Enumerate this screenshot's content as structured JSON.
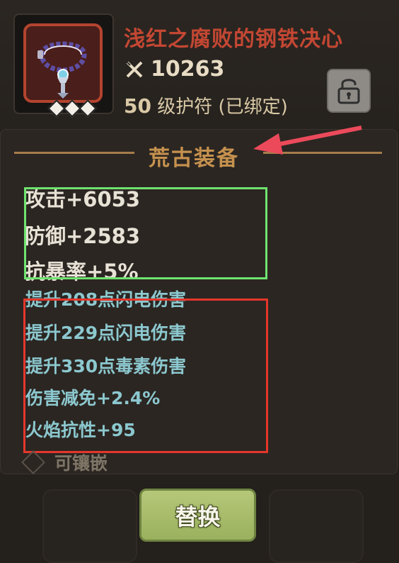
{
  "item": {
    "name": "浅红之腐败的钢铁决心",
    "power": "10263",
    "level_num": "50",
    "level_text": "级护符",
    "bound_text": "(已绑定)",
    "rarity_diamonds": 3
  },
  "section": {
    "title": "荒古装备"
  },
  "base_stats": [
    "攻击+6053",
    "防御+2583",
    "抗暴率+5%"
  ],
  "sub_stats": [
    "提升208点闪电伤害",
    "提升229点闪电伤害",
    "提升330点毒素伤害",
    "伤害减免+2.4%",
    "火焰抗性+95"
  ],
  "socket": {
    "label": "可镶嵌"
  },
  "actions": {
    "replace_label": "替换"
  },
  "colors": {
    "item_name": "#c34733",
    "section_title": "#c6914e",
    "substat": "#8cc8cf",
    "highlight_green": "#6fe36f",
    "highlight_red": "#e5362b",
    "arrow": "#ec4a5b",
    "button": "#a9bc6b"
  },
  "icons": {
    "power": "crossed-swords-icon",
    "lock": "unlocked-padlock-icon",
    "item": "amulet-necklace-icon"
  }
}
